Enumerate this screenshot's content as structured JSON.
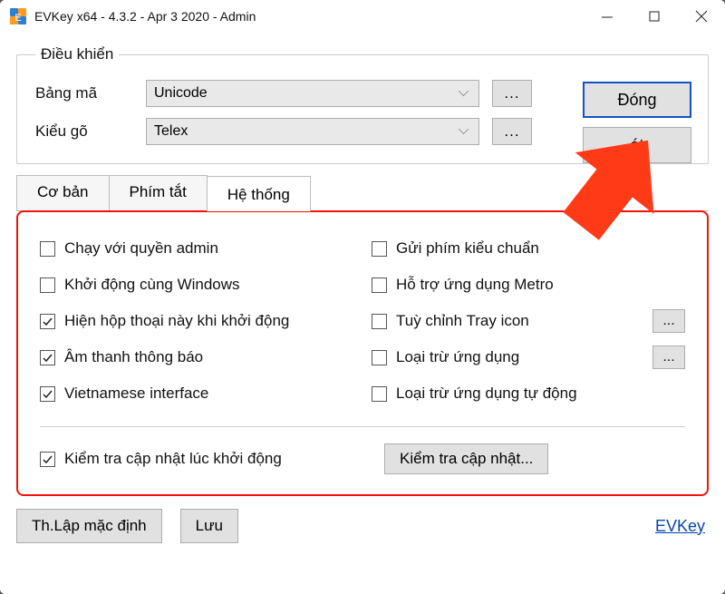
{
  "window": {
    "title": "EVKey x64 - 4.3.2 - Apr  3 2020 - Admin"
  },
  "group_title": "Điều khiển",
  "rows": {
    "encoding_label": "Bảng mã",
    "encoding_value": "Unicode",
    "method_label": "Kiểu gõ",
    "method_value": "Telex"
  },
  "buttons": {
    "dots": "...",
    "close": "Đóng",
    "exit": "át",
    "defaults": "Th.Lập mặc định",
    "save": "Lưu",
    "check_update": "Kiểm tra cập nhật...",
    "link": "EVKey"
  },
  "tabs": {
    "basic": "Cơ bản",
    "hotkey": "Phím tắt",
    "system": "Hệ thống"
  },
  "checks": {
    "left": [
      {
        "label": "Chạy với quyền admin",
        "checked": false
      },
      {
        "label": "Khởi động cùng Windows",
        "checked": false
      },
      {
        "label": "Hiện hộp thoại này khi khởi động",
        "checked": true
      },
      {
        "label": "Âm thanh thông báo",
        "checked": true
      },
      {
        "label": "Vietnamese interface",
        "checked": true
      }
    ],
    "right": [
      {
        "label": "Gửi phím kiểu chuẩn",
        "checked": false,
        "btn": false
      },
      {
        "label": "Hỗ trợ ứng dụng Metro",
        "checked": false,
        "btn": false
      },
      {
        "label": "Tuỳ chỉnh Tray icon",
        "checked": false,
        "btn": true
      },
      {
        "label": "Loại trừ ứng dụng",
        "checked": false,
        "btn": true
      },
      {
        "label": "Loại trừ ứng dụng tự động",
        "checked": false,
        "btn": false
      }
    ],
    "update": {
      "label": "Kiểm tra cập nhật lúc khởi động",
      "checked": true
    }
  }
}
